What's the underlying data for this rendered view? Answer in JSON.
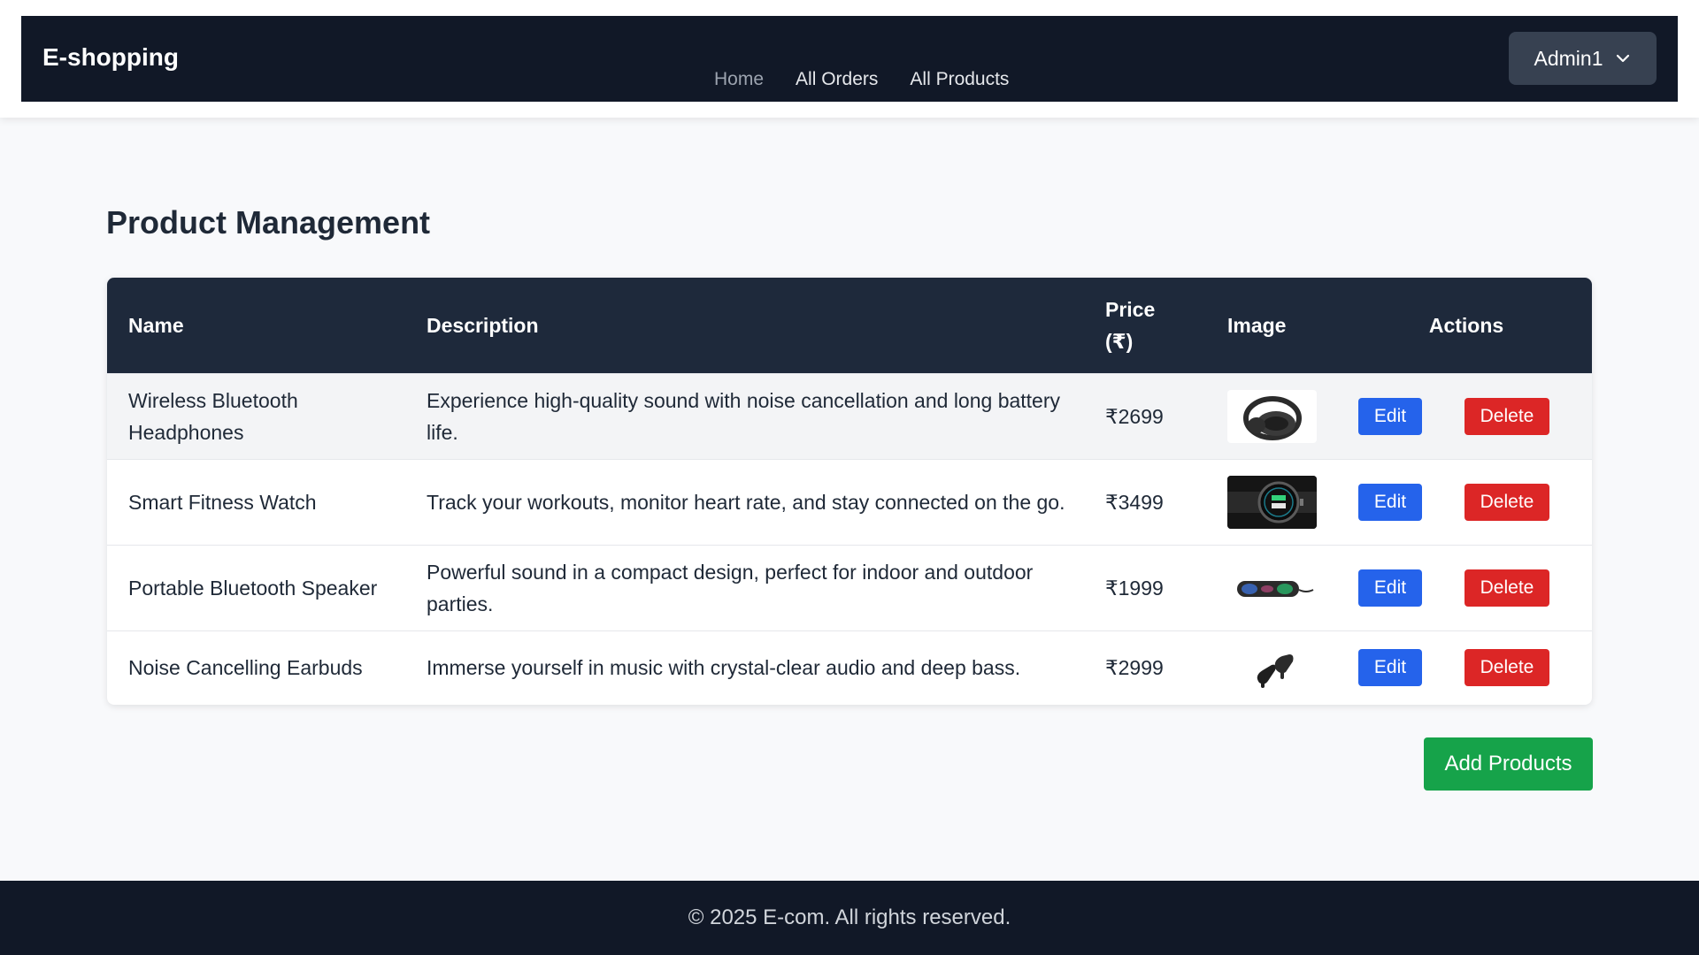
{
  "header": {
    "brand": "E-shopping",
    "nav": [
      {
        "label": "Home"
      },
      {
        "label": "All Orders"
      },
      {
        "label": "All Products"
      }
    ],
    "user_menu_label": "Admin1"
  },
  "main": {
    "title": "Product Management",
    "table": {
      "columns": [
        "Name",
        "Description",
        "Price (₹)",
        "Image",
        "Actions"
      ],
      "rows": [
        {
          "name": "Wireless Bluetooth Headphones",
          "description": "Experience high-quality sound with noise cancellation and long battery life.",
          "price": "₹2699",
          "image_icon": "headphones-icon",
          "edit_label": "Edit",
          "delete_label": "Delete"
        },
        {
          "name": "Smart Fitness Watch",
          "description": "Track your workouts, monitor heart rate, and stay connected on the go.",
          "price": "₹3499",
          "image_icon": "smartwatch-icon",
          "edit_label": "Edit",
          "delete_label": "Delete"
        },
        {
          "name": "Portable Bluetooth Speaker",
          "description": "Powerful sound in a compact design, perfect for indoor and outdoor parties.",
          "price": "₹1999",
          "image_icon": "speaker-icon",
          "edit_label": "Edit",
          "delete_label": "Delete"
        },
        {
          "name": "Noise Cancelling Earbuds",
          "description": "Immerse yourself in music with crystal-clear audio and deep bass.",
          "price": "₹2999",
          "image_icon": "earbuds-icon",
          "edit_label": "Edit",
          "delete_label": "Delete"
        }
      ]
    },
    "add_button_label": "Add Products"
  },
  "footer": {
    "text": "© 2025 E-com. All rights reserved."
  },
  "colors": {
    "navbar_bg": "#111827",
    "table_header_bg": "#1e293b",
    "edit_button": "#2563eb",
    "delete_button": "#dc2626",
    "add_button": "#16a34a"
  }
}
